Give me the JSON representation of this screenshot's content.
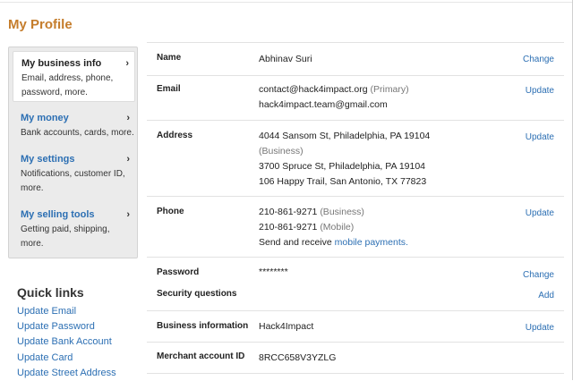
{
  "page": {
    "title": "My Profile"
  },
  "sidebar": {
    "items": [
      {
        "title": "My business info",
        "desc": [
          "Email, address, phone,",
          "password, more."
        ]
      },
      {
        "title": "My money",
        "desc": [
          "Bank accounts, cards, more."
        ]
      },
      {
        "title": "My settings",
        "desc": [
          "Notifications, customer ID,",
          "more."
        ]
      },
      {
        "title": "My selling tools",
        "desc": [
          "Getting paid, shipping,",
          "more."
        ]
      }
    ],
    "chevron": "›"
  },
  "quick_links": {
    "title": "Quick links",
    "items": [
      "Update Email",
      "Update Password",
      "Update Bank Account",
      "Update Card",
      "Update Street Address"
    ]
  },
  "profile": {
    "name": {
      "label": "Name",
      "value": "Abhinav Suri",
      "action": "Change"
    },
    "email": {
      "label": "Email",
      "primary": "contact@hack4impact.org",
      "primary_tag": "(Primary)",
      "secondary": "hack4impact.team@gmail.com",
      "action": "Update"
    },
    "address": {
      "label": "Address",
      "line1": "4044 Sansom St, Philadelphia, PA 19104",
      "line1_tag": "(Business)",
      "line2": "3700 Spruce St, Philadelphia, PA 19104",
      "line3": "106 Happy Trail, San Antonio, TX 77823",
      "action": "Update"
    },
    "phone": {
      "label": "Phone",
      "number1": "210-861-9271",
      "tag1": "(Business)",
      "number2": "210-861-9271",
      "tag2": "(Mobile)",
      "send_text": "Send and receive",
      "send_link": "mobile payments.",
      "action": "Update"
    },
    "password": {
      "label": "Password",
      "value": "********",
      "action": "Change"
    },
    "security": {
      "label": "Security questions",
      "action": "Add"
    },
    "business_info": {
      "label": "Business information",
      "value": "Hack4Impact",
      "action": "Update"
    },
    "merchant": {
      "label": "Merchant account ID",
      "value": "8RCC658V3YZLG"
    }
  }
}
